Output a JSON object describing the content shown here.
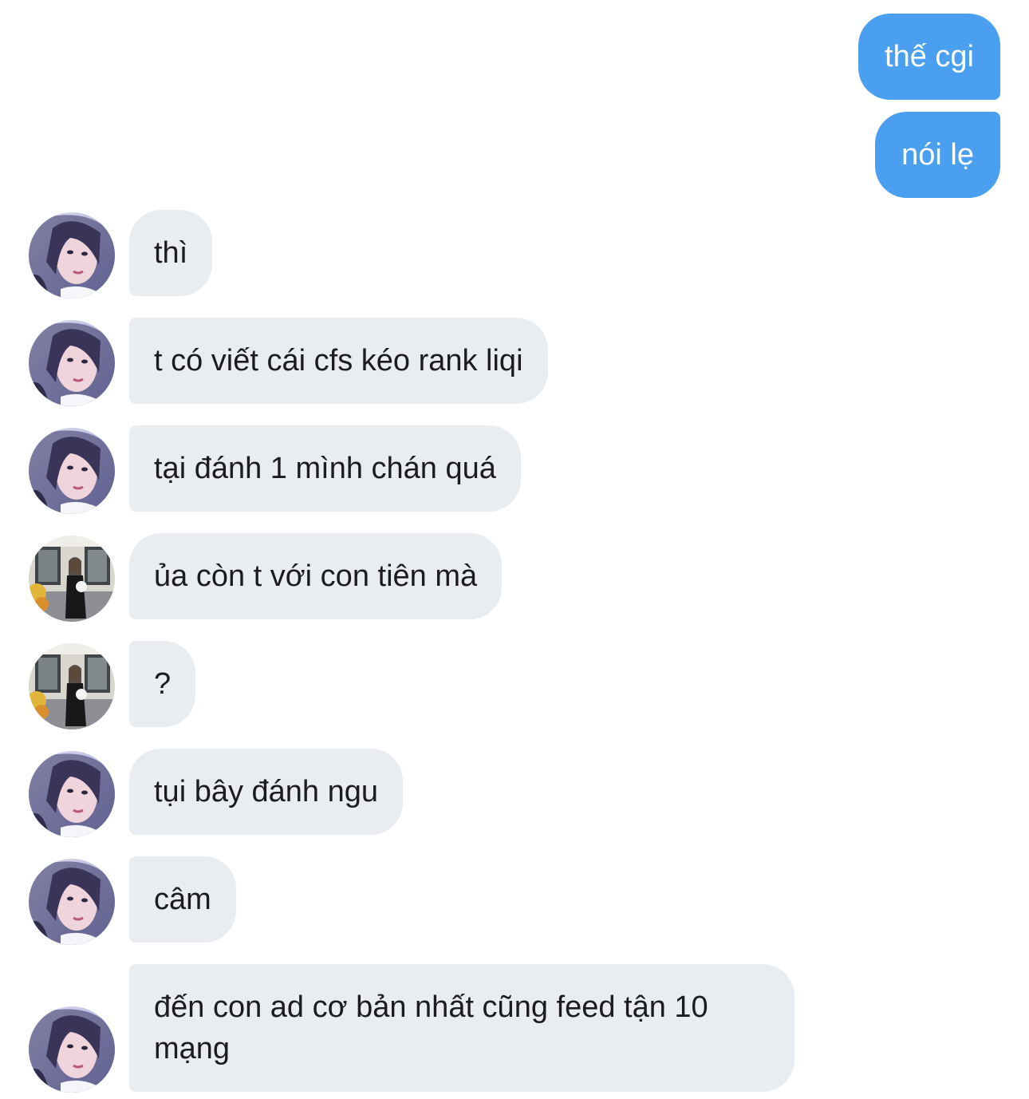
{
  "conversation": {
    "messages": [
      {
        "direction": "outgoing",
        "text": "thế cgi"
      },
      {
        "direction": "outgoing",
        "text": "nói lẹ"
      },
      {
        "direction": "incoming",
        "avatar": "selfie-avatar-icon",
        "text": "thì"
      },
      {
        "direction": "incoming",
        "avatar": "selfie-avatar-icon",
        "text": "t có viết cái cfs kéo rank liqi"
      },
      {
        "direction": "incoming",
        "avatar": "selfie-avatar-icon",
        "text": "tại đánh 1 mình chán quá"
      },
      {
        "direction": "incoming",
        "avatar": "storefront-avatar-icon",
        "text": "ủa còn t với con tiên mà"
      },
      {
        "direction": "incoming",
        "avatar": "storefront-avatar-icon",
        "text": "?"
      },
      {
        "direction": "incoming",
        "avatar": "selfie-avatar-icon",
        "text": "tụi bây đánh ngu"
      },
      {
        "direction": "incoming",
        "avatar": "selfie-avatar-icon",
        "text": "câm"
      },
      {
        "direction": "incoming",
        "avatar": "selfie-avatar-icon",
        "text": "đến con ad cơ bản nhất cũng feed tận 10 mạng"
      }
    ]
  },
  "colors": {
    "outgoing_bubble": "#4a9ff0",
    "incoming_bubble": "#e9ecf1",
    "background": "#ffffff"
  }
}
